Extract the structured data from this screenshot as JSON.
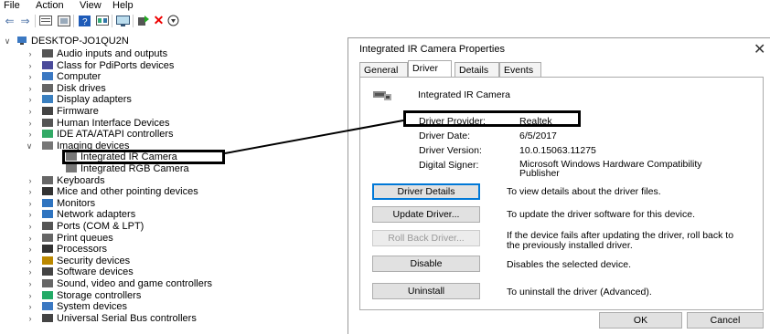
{
  "menu": {
    "file": "File",
    "action": "Action",
    "view": "View",
    "help": "Help"
  },
  "tree": {
    "root": "DESKTOP-JO1QU2N",
    "items": [
      {
        "label": "Audio inputs and outputs",
        "icon": "speaker-icon",
        "expanded": false
      },
      {
        "label": "Class for PdiPorts devices",
        "icon": "port-device-icon",
        "expanded": false
      },
      {
        "label": "Computer",
        "icon": "computer-icon",
        "expanded": false
      },
      {
        "label": "Disk drives",
        "icon": "disk-drive-icon",
        "expanded": false
      },
      {
        "label": "Display adapters",
        "icon": "display-adapter-icon",
        "expanded": false
      },
      {
        "label": "Firmware",
        "icon": "firmware-icon",
        "expanded": false
      },
      {
        "label": "Human Interface Devices",
        "icon": "hid-icon",
        "expanded": false
      },
      {
        "label": "IDE ATA/ATAPI controllers",
        "icon": "ide-controller-icon",
        "expanded": false
      },
      {
        "label": "Imaging devices",
        "icon": "camera-icon",
        "expanded": true
      },
      {
        "label": "Integrated IR Camera",
        "icon": "camera-icon",
        "child": true,
        "selected": true
      },
      {
        "label": "Integrated RGB Camera",
        "icon": "camera-icon",
        "child": true
      },
      {
        "label": "Keyboards",
        "icon": "keyboard-icon",
        "expanded": false
      },
      {
        "label": "Mice and other pointing devices",
        "icon": "mouse-icon",
        "expanded": false
      },
      {
        "label": "Monitors",
        "icon": "monitor-icon",
        "expanded": false
      },
      {
        "label": "Network adapters",
        "icon": "network-adapter-icon",
        "expanded": false
      },
      {
        "label": "Ports (COM & LPT)",
        "icon": "port-icon",
        "expanded": false
      },
      {
        "label": "Print queues",
        "icon": "printer-icon",
        "expanded": false
      },
      {
        "label": "Processors",
        "icon": "processor-icon",
        "expanded": false
      },
      {
        "label": "Security devices",
        "icon": "security-device-icon",
        "expanded": false
      },
      {
        "label": "Software devices",
        "icon": "software-device-icon",
        "expanded": false
      },
      {
        "label": "Sound, video and game controllers",
        "icon": "sound-icon",
        "expanded": false
      },
      {
        "label": "Storage controllers",
        "icon": "storage-controller-icon",
        "expanded": false
      },
      {
        "label": "System devices",
        "icon": "system-device-icon",
        "expanded": false
      },
      {
        "label": "Universal Serial Bus controllers",
        "icon": "usb-icon",
        "expanded": false
      }
    ]
  },
  "dialog": {
    "title": "Integrated IR Camera Properties",
    "close": "✕",
    "tabs": [
      "General",
      "Driver",
      "Details",
      "Events"
    ],
    "active_tab": "Driver",
    "device_name": "Integrated IR Camera",
    "provider_label": "Driver Provider:",
    "provider_value": "Realtek",
    "date_label": "Driver Date:",
    "date_value": "6/5/2017",
    "version_label": "Driver Version:",
    "version_value": "10.0.15063.11275",
    "signer_label": "Digital Signer:",
    "signer_value": "Microsoft Windows Hardware Compatibility Publisher",
    "buttons": {
      "details": "Driver Details",
      "update": "Update Driver...",
      "rollback": "Roll Back Driver...",
      "disable": "Disable",
      "uninstall": "Uninstall"
    },
    "descriptions": {
      "details": "To view details about the driver files.",
      "update": "To update the driver software for this device.",
      "rollback": "If the device fails after updating the driver, roll back to the previously installed driver.",
      "disable": "Disables the selected device.",
      "uninstall": "To uninstall the driver (Advanced)."
    },
    "ok": "OK",
    "cancel": "Cancel"
  }
}
